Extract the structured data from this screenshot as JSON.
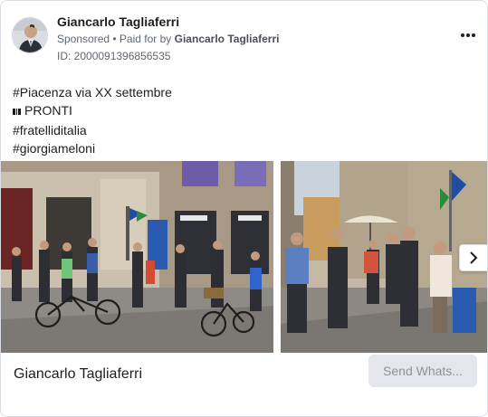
{
  "advertiser": {
    "name": "Giancarlo Tagliaferri",
    "sponsored_label": "Sponsored",
    "paid_for_prefix": "• Paid for by",
    "paid_for_name": "Giancarlo Tagliaferri",
    "ad_id": "ID: 2000091396856535"
  },
  "ad_text": {
    "line1": "#Piacenza via XX settembre",
    "flag_icon": "italy-flag-icon",
    "line2_text": "PRONTI",
    "line3": "#fratelliditalia",
    "line4": "#giorgiameloni"
  },
  "carousel": {
    "images": [
      {
        "description_icon": "event-photo-street-gathering"
      },
      {
        "description_icon": "event-photo-people-talking"
      }
    ],
    "next_icon": "chevron-right-icon"
  },
  "footer": {
    "page_name": "Giancarlo Tagliaferri",
    "cta_label": "Send Whats..."
  },
  "colors": {
    "text_primary": "#1c1e21",
    "text_secondary": "#606770",
    "button_bg": "#e4e6eb",
    "button_text": "#8d949e",
    "border": "#dadde1"
  }
}
